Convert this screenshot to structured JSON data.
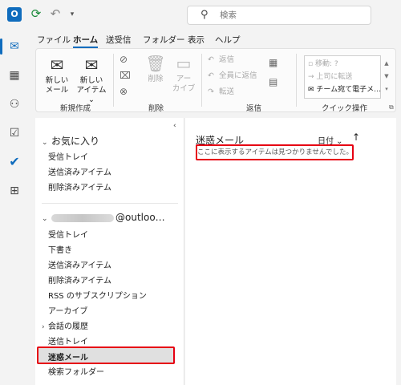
{
  "titlebar": {
    "app_icon_letter": "O",
    "search_placeholder": "検索"
  },
  "tabs": [
    {
      "label": "ファイル"
    },
    {
      "label": "ホーム"
    },
    {
      "label": "送受信"
    },
    {
      "label": "フォルダー"
    },
    {
      "label": "表示"
    },
    {
      "label": "ヘルプ"
    }
  ],
  "ribbon": {
    "new_mail": "新しい\nメール",
    "new_mail_l1": "新しい",
    "new_mail_l2": "メール",
    "new_item_l1": "新しい",
    "new_item_l2": "アイテム ⌄",
    "group_new": "新規作成",
    "delete_label": "削除",
    "archive_l1": "アー",
    "archive_l2": "カイブ",
    "group_delete": "削除",
    "reply": "返信",
    "reply_all": "全員に返信",
    "forward": "転送",
    "group_respond": "返信",
    "qs_move": "移動: ?",
    "qs_to_manager": "上司に転送",
    "qs_team_email": "チーム宛て電子メ…",
    "group_quicksteps": "クイック操作"
  },
  "folders": {
    "favorites_header": "お気に入り",
    "favorites": [
      {
        "label": "受信トレイ"
      },
      {
        "label": "送信済みアイテム"
      },
      {
        "label": "削除済みアイテム"
      }
    ],
    "account_suffix": "@outloo…",
    "account_folders": [
      {
        "label": "受信トレイ"
      },
      {
        "label": "下書き"
      },
      {
        "label": "送信済みアイテム"
      },
      {
        "label": "削除済みアイテム"
      },
      {
        "label": "RSS のサブスクリプション"
      },
      {
        "label": "アーカイブ"
      },
      {
        "label": "会話の履歴"
      },
      {
        "label": "送信トレイ"
      },
      {
        "label": "迷惑メール"
      },
      {
        "label": "検索フォルダー"
      }
    ]
  },
  "message_list": {
    "title": "迷惑メール",
    "sort_label": "日付 ⌄",
    "sort_direction": "↑",
    "empty_text": "ここに表示するアイテムは見つかりませんでした。"
  },
  "colors": {
    "accent": "#0f6cbd",
    "highlight_border": "#e60012"
  }
}
